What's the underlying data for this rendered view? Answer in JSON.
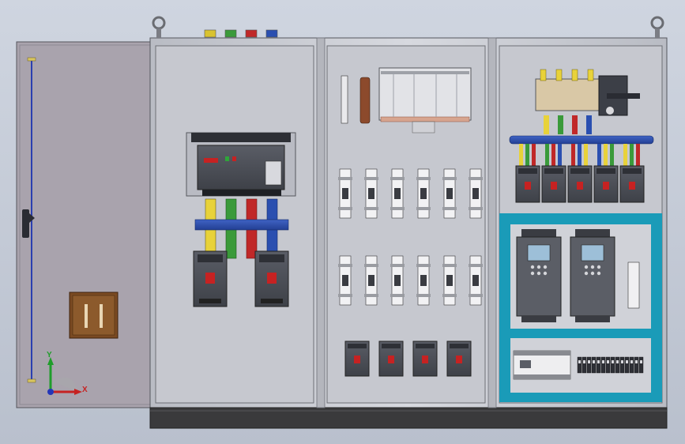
{
  "scene": {
    "colors": {
      "background_top": "#cfd5e0",
      "background_bottom": "#b9c0cd",
      "cabinet_frame": "#c9cbd3",
      "panel": "#c6c8cf",
      "door": "#a9a3ad",
      "plinth": "#3a3a3c",
      "busbar_yellow": "#e8d23a",
      "busbar_green": "#3a9a3a",
      "busbar_red": "#c02828",
      "busbar_blue": "#2a4fb0",
      "breaker_body": "#4a4d55",
      "accent_cyan": "#1a9bb8",
      "vfd_body": "#5b5e66",
      "wood": "#7a4a22"
    },
    "axis_triad": {
      "y_label": "Y",
      "x_label": "X"
    },
    "components": {
      "main_breaker": {
        "count": 1
      },
      "molded_case_breakers_left": {
        "count": 2
      },
      "din_breakers_upper_row": {
        "count": 6
      },
      "din_breakers_lower_row": {
        "count": 6
      },
      "small_breakers_bottom_row": {
        "count": 4
      },
      "feeder_breakers_right": {
        "count": 5
      },
      "vfd_drives": {
        "count": 2
      },
      "terminal_blocks": {
        "count": 14
      }
    },
    "icons": [
      "lifting-eye-icon",
      "axis-triad-icon",
      "handle-icon"
    ]
  }
}
